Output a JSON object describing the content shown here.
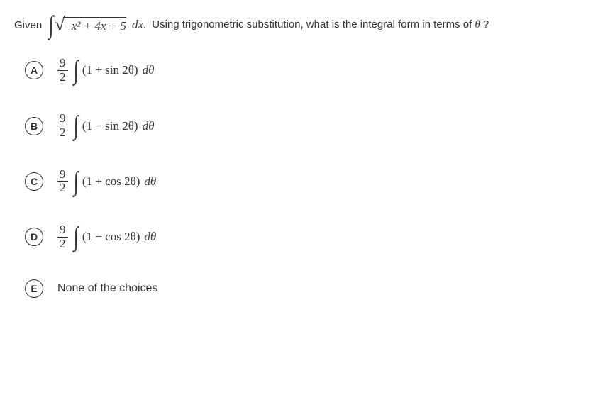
{
  "question": {
    "given_label": "Given",
    "integral_inner": "−x² + 4x + 5",
    "dx": "dx.",
    "after_text": "Using trigonometric substitution, what is the integral form in terms of",
    "theta": "θ",
    "qmark": "?"
  },
  "options": {
    "a": {
      "letter": "A",
      "frac_num": "9",
      "frac_den": "2",
      "integrand": "(1 + sin 2θ)",
      "dtheta": "dθ"
    },
    "b": {
      "letter": "B",
      "frac_num": "9",
      "frac_den": "2",
      "integrand": "(1 − sin 2θ)",
      "dtheta": "dθ"
    },
    "c": {
      "letter": "C",
      "frac_num": "9",
      "frac_den": "2",
      "integrand": "(1 + cos 2θ)",
      "dtheta": "dθ"
    },
    "d": {
      "letter": "D",
      "frac_num": "9",
      "frac_den": "2",
      "integrand": "(1 − cos 2θ)",
      "dtheta": "dθ"
    },
    "e": {
      "letter": "E",
      "text": "None of the choices"
    }
  },
  "chart_data": {
    "type": "table",
    "title": "Multiple choice question: trigonometric substitution integral",
    "question": "Given ∫√(−x²+4x+5) dx, what is the integral form in terms of θ?",
    "choices": [
      {
        "label": "A",
        "value": "(9/2)∫(1+sin 2θ) dθ"
      },
      {
        "label": "B",
        "value": "(9/2)∫(1−sin 2θ) dθ"
      },
      {
        "label": "C",
        "value": "(9/2)∫(1+cos 2θ) dθ"
      },
      {
        "label": "D",
        "value": "(9/2)∫(1−cos 2θ) dθ"
      },
      {
        "label": "E",
        "value": "None of the choices"
      }
    ]
  }
}
